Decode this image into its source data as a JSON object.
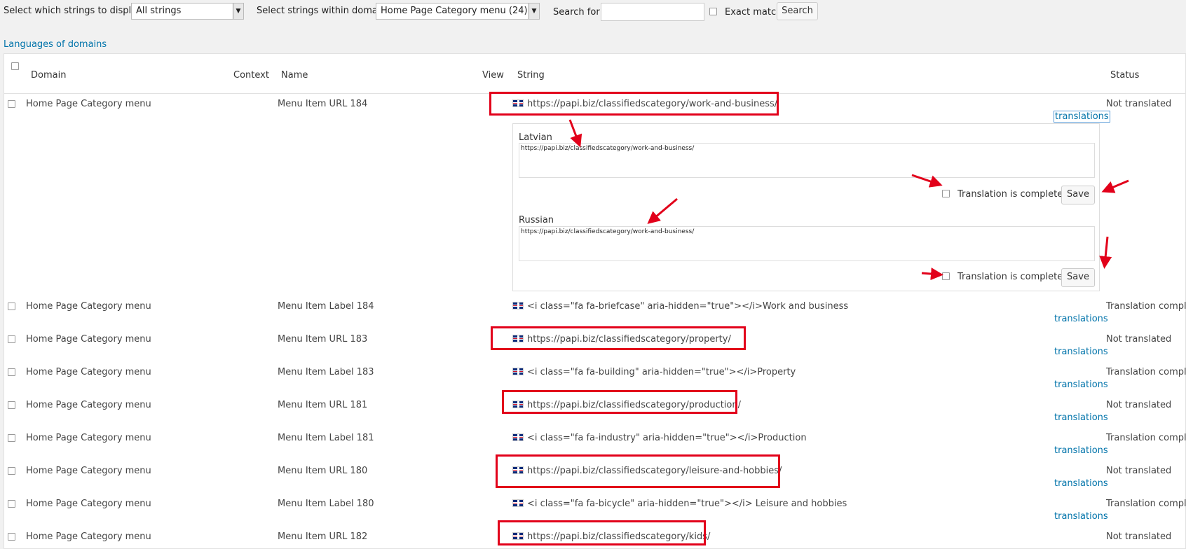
{
  "filters": {
    "display_label": "Select which strings to display:",
    "display_value": "All strings",
    "domain_label": "Select strings within domain:",
    "domain_value": "Home Page Category menu (24)",
    "search_label": "Search for:",
    "search_value": "",
    "exact_match_label": "Exact match",
    "search_button": "Search"
  },
  "languages_link": "Languages of domains",
  "columns": {
    "domain": "Domain",
    "context": "Context",
    "name": "Name",
    "view": "View",
    "string": "String",
    "status": "Status"
  },
  "translations_link": "translations",
  "rows": [
    {
      "domain": "Home Page Category menu",
      "name": "Menu Item URL 184",
      "string": "https://papi.biz/classifiedscategory/work-and-business/",
      "status": "Not translated"
    },
    {
      "domain": "Home Page Category menu",
      "name": "Menu Item Label 184",
      "string": "<i class=\"fa fa-briefcase\" aria-hidden=\"true\"></i>Work and business",
      "status": "Translation complete"
    },
    {
      "domain": "Home Page Category menu",
      "name": "Menu Item URL 183",
      "string": "https://papi.biz/classifiedscategory/property/",
      "status": "Not translated"
    },
    {
      "domain": "Home Page Category menu",
      "name": "Menu Item Label 183",
      "string": "<i class=\"fa fa-building\" aria-hidden=\"true\"></i>Property",
      "status": "Translation complete"
    },
    {
      "domain": "Home Page Category menu",
      "name": "Menu Item URL 181",
      "string": "https://papi.biz/classifiedscategory/production/",
      "status": "Not translated"
    },
    {
      "domain": "Home Page Category menu",
      "name": "Menu Item Label 181",
      "string": "<i class=\"fa fa-industry\" aria-hidden=\"true\"></i>Production",
      "status": "Translation complete"
    },
    {
      "domain": "Home Page Category menu",
      "name": "Menu Item URL 180",
      "string": "https://papi.biz/classifiedscategory/leisure-and-hobbies/",
      "status": "Not translated"
    },
    {
      "domain": "Home Page Category menu",
      "name": "Menu Item Label 180",
      "string": "<i class=\"fa fa-bicycle\" aria-hidden=\"true\"></i> Leisure and hobbies",
      "status": "Translation complete"
    },
    {
      "domain": "Home Page Category menu",
      "name": "Menu Item URL 182",
      "string": "https://papi.biz/classifiedscategory/kids/",
      "status": "Not translated"
    }
  ],
  "translation_panel": {
    "languages": [
      {
        "language": "Latvian",
        "value": "https://papi.biz/classifiedscategory/work-and-business/",
        "complete_label": "Translation is complete",
        "save": "Save"
      },
      {
        "language": "Russian",
        "value": "https://papi.biz/classifiedscategory/work-and-business/",
        "complete_label": "Translation is complete",
        "save": "Save"
      }
    ]
  },
  "colors": {
    "annotation_red": "#e2001a",
    "link_blue": "#0073aa"
  }
}
